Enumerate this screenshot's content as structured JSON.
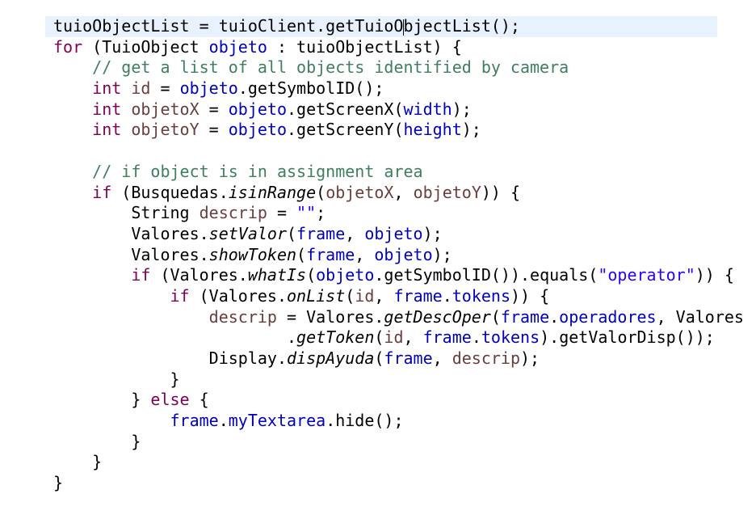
{
  "lines": [
    [
      {
        "t": "tuioObjectList = tuioClient.getTuioO"
      },
      {
        "caret": true
      },
      {
        "t": "bjectList();"
      }
    ],
    [
      {
        "t": "for",
        "c": "kw"
      },
      {
        "t": " (TuioObject "
      },
      {
        "t": "objeto",
        "c": "field"
      },
      {
        "t": " : tuioObjectList) {"
      }
    ],
    [
      {
        "t": "    "
      },
      {
        "t": "// get a list of all objects identified by camera",
        "c": "comment"
      }
    ],
    [
      {
        "t": "    "
      },
      {
        "t": "int",
        "c": "kw"
      },
      {
        "t": " "
      },
      {
        "t": "id",
        "c": "local"
      },
      {
        "t": " = "
      },
      {
        "t": "objeto",
        "c": "field"
      },
      {
        "t": ".getSymbolID();"
      }
    ],
    [
      {
        "t": "    "
      },
      {
        "t": "int",
        "c": "kw"
      },
      {
        "t": " "
      },
      {
        "t": "objetoX",
        "c": "local"
      },
      {
        "t": " = "
      },
      {
        "t": "objeto",
        "c": "field"
      },
      {
        "t": ".getScreenX("
      },
      {
        "t": "width",
        "c": "field"
      },
      {
        "t": ");"
      }
    ],
    [
      {
        "t": "    "
      },
      {
        "t": "int",
        "c": "kw"
      },
      {
        "t": " "
      },
      {
        "t": "objetoY",
        "c": "local"
      },
      {
        "t": " = "
      },
      {
        "t": "objeto",
        "c": "field"
      },
      {
        "t": ".getScreenY("
      },
      {
        "t": "height",
        "c": "field"
      },
      {
        "t": ");"
      }
    ],
    [
      {
        "t": ""
      }
    ],
    [
      {
        "t": "    "
      },
      {
        "t": "// if object is in assignment area",
        "c": "comment"
      }
    ],
    [
      {
        "t": "    "
      },
      {
        "t": "if",
        "c": "kw"
      },
      {
        "t": " (Busquedas."
      },
      {
        "t": "isinRange",
        "c": "static"
      },
      {
        "t": "("
      },
      {
        "t": "objetoX",
        "c": "local"
      },
      {
        "t": ", "
      },
      {
        "t": "objetoY",
        "c": "local"
      },
      {
        "t": ")) {"
      }
    ],
    [
      {
        "t": "        String "
      },
      {
        "t": "descrip",
        "c": "local"
      },
      {
        "t": " = "
      },
      {
        "t": "\"\"",
        "c": "str"
      },
      {
        "t": ";"
      }
    ],
    [
      {
        "t": "        Valores."
      },
      {
        "t": "setValor",
        "c": "static"
      },
      {
        "t": "("
      },
      {
        "t": "frame",
        "c": "field"
      },
      {
        "t": ", "
      },
      {
        "t": "objeto",
        "c": "field"
      },
      {
        "t": ");"
      }
    ],
    [
      {
        "t": "        Valores."
      },
      {
        "t": "showToken",
        "c": "static"
      },
      {
        "t": "("
      },
      {
        "t": "frame",
        "c": "field"
      },
      {
        "t": ", "
      },
      {
        "t": "objeto",
        "c": "field"
      },
      {
        "t": ");"
      }
    ],
    [
      {
        "t": "        "
      },
      {
        "t": "if",
        "c": "kw"
      },
      {
        "t": " (Valores."
      },
      {
        "t": "whatIs",
        "c": "static"
      },
      {
        "t": "("
      },
      {
        "t": "objeto",
        "c": "field"
      },
      {
        "t": ".getSymbolID()).equals("
      },
      {
        "t": "\"operator\"",
        "c": "str"
      },
      {
        "t": ")) {"
      }
    ],
    [
      {
        "t": "            "
      },
      {
        "t": "if",
        "c": "kw"
      },
      {
        "t": " (Valores."
      },
      {
        "t": "onList",
        "c": "static"
      },
      {
        "t": "("
      },
      {
        "t": "id",
        "c": "local"
      },
      {
        "t": ", "
      },
      {
        "t": "frame",
        "c": "field"
      },
      {
        "t": "."
      },
      {
        "t": "tokens",
        "c": "field"
      },
      {
        "t": ")) {"
      }
    ],
    [
      {
        "t": "                "
      },
      {
        "t": "descrip",
        "c": "local"
      },
      {
        "t": " = Valores."
      },
      {
        "t": "getDescOper",
        "c": "static"
      },
      {
        "t": "("
      },
      {
        "t": "frame",
        "c": "field"
      },
      {
        "t": "."
      },
      {
        "t": "operadores",
        "c": "field"
      },
      {
        "t": ", Valores"
      }
    ],
    [
      {
        "t": "                        ."
      },
      {
        "t": "getToken",
        "c": "static"
      },
      {
        "t": "("
      },
      {
        "t": "id",
        "c": "local"
      },
      {
        "t": ", "
      },
      {
        "t": "frame",
        "c": "field"
      },
      {
        "t": "."
      },
      {
        "t": "tokens",
        "c": "field"
      },
      {
        "t": ").getValorDisp());"
      }
    ],
    [
      {
        "t": "                Display."
      },
      {
        "t": "dispAyuda",
        "c": "static"
      },
      {
        "t": "("
      },
      {
        "t": "frame",
        "c": "field"
      },
      {
        "t": ", "
      },
      {
        "t": "descrip",
        "c": "local"
      },
      {
        "t": ");"
      }
    ],
    [
      {
        "t": "            }"
      }
    ],
    [
      {
        "t": "        } "
      },
      {
        "t": "else",
        "c": "kw"
      },
      {
        "t": " {"
      }
    ],
    [
      {
        "t": "            "
      },
      {
        "t": "frame",
        "c": "field"
      },
      {
        "t": "."
      },
      {
        "t": "myTextarea",
        "c": "field"
      },
      {
        "t": ".hide();"
      }
    ],
    [
      {
        "t": "        }"
      }
    ],
    [
      {
        "t": "    }"
      }
    ],
    [
      {
        "t": "}"
      }
    ]
  ],
  "colors": {
    "keyword": "#7f0055",
    "field": "#0000c0",
    "string": "#2a00ff",
    "comment": "#3f7f5f",
    "local": "#6a3e3e",
    "current_line": "#e8f2fe"
  }
}
